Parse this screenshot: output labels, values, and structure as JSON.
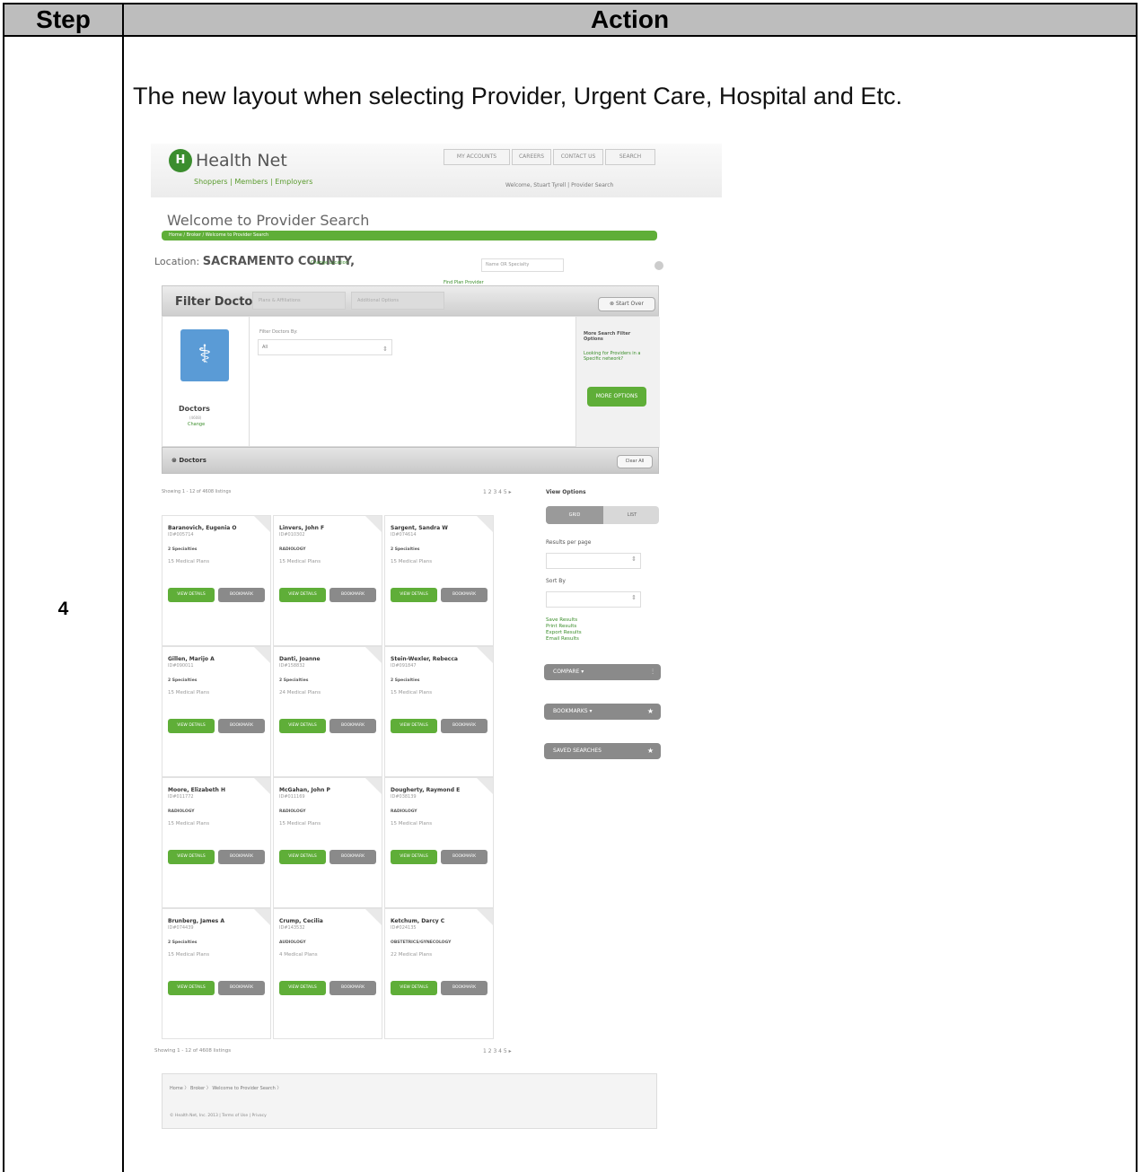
{
  "table": {
    "header_step": "Step",
    "header_action": "Action",
    "step_number": "4",
    "caption": "The new layout when selecting Provider, Urgent Care, Hospital and Etc."
  },
  "screenshot": {
    "logo_text": "Health Net",
    "nav_links": "Shoppers | Members | Employers",
    "top_nav": [
      "MY ACCOUNTS",
      "CAREERS",
      "CONTACT US",
      "SEARCH"
    ],
    "welcome_right": "Welcome, Stuart Tyrell | Provider Search",
    "page_title": "Welcome to Provider Search",
    "green_breadcrumb": "Home / Broker / Welcome to Provider Search",
    "location_label": "Location:",
    "location_value": "SACRAMENTO COUNTY,",
    "change_location": "Change Location",
    "location_search_placeholder": "Name OR Specialty",
    "find_plan_provider": "Find Plan Provider",
    "filter_title": "Filter Doctors",
    "filter_tabs": [
      "Plans & Affiliations",
      "Additional Options"
    ],
    "start_over": "Start Over",
    "doctors_tile_label": "Doctors",
    "doctors_sub": "(4608)",
    "doctors_change": "Change",
    "filter_by_label": "Filter Doctors By:",
    "filter_by_value": "All",
    "more_search_heading": "More Search Filter Options",
    "more_search_text": "Looking for Providers in a Specific network?",
    "more_options_button": "MORE OPTIONS",
    "doctors_bar_label": "Doctors",
    "clear_all": "Clear All",
    "showing_text": "Showing 1 - 12 of 4608 listings",
    "pager_text": "1  2  3  4  5  ▸",
    "view_options_label": "View Options",
    "view_toggle": [
      "GRID",
      "LIST"
    ],
    "results_per_page_label": "Results per page",
    "sort_by_label": "Sort By",
    "result_links": [
      "Save Results",
      "Print Results",
      "Export Results",
      "Email Results"
    ],
    "side_buttons": [
      "COMPARE ▾",
      "BOOKMARKS ▾",
      "SAVED SEARCHES"
    ],
    "view_details_label": "VIEW DETAILS",
    "bookmark_label": "BOOKMARK",
    "cards": [
      {
        "name": "Baranovich, Eugenia O",
        "id": "ID#005714",
        "spec": "2 Specialties",
        "plans": "15 Medical Plans"
      },
      {
        "name": "Linvers, John F",
        "id": "ID#010302",
        "spec": "RADIOLOGY",
        "plans": "15 Medical Plans"
      },
      {
        "name": "Sargent, Sandra W",
        "id": "ID#074614",
        "spec": "2 Specialties",
        "plans": "15 Medical Plans"
      },
      {
        "name": "Gillen, Marijo A",
        "id": "ID#090011",
        "spec": "2 Specialties",
        "plans": "15 Medical Plans"
      },
      {
        "name": "Danti, Joanne",
        "id": "ID#158832",
        "spec": "2 Specialties",
        "plans": "24 Medical Plans"
      },
      {
        "name": "Stein-Wexler, Rebecca",
        "id": "ID#091847",
        "spec": "2 Specialties",
        "plans": "15 Medical Plans"
      },
      {
        "name": "Moore, Elizabeth H",
        "id": "ID#011772",
        "spec": "RADIOLOGY",
        "plans": "15 Medical Plans"
      },
      {
        "name": "McGahan, John P",
        "id": "ID#011169",
        "spec": "RADIOLOGY",
        "plans": "15 Medical Plans"
      },
      {
        "name": "Dougherty, Raymond E",
        "id": "ID#038139",
        "spec": "RADIOLOGY",
        "plans": "15 Medical Plans"
      },
      {
        "name": "Brunberg, James A",
        "id": "ID#074439",
        "spec": "2 Specialties",
        "plans": "15 Medical Plans"
      },
      {
        "name": "Crump, Cecilia",
        "id": "ID#143532",
        "spec": "AUDIOLOGY",
        "plans": "4 Medical Plans"
      },
      {
        "name": "Ketchum, Darcy C",
        "id": "ID#024135",
        "spec": "OBSTETRICS/GYNECOLOGY",
        "plans": "22 Medical Plans"
      }
    ],
    "footer_crumbs": "Home  〉 Broker  〉 Welcome to Provider Search  〉",
    "footer_copy": "© Health Net, Inc. 2013   |   Terms of Use   |   Privacy"
  }
}
